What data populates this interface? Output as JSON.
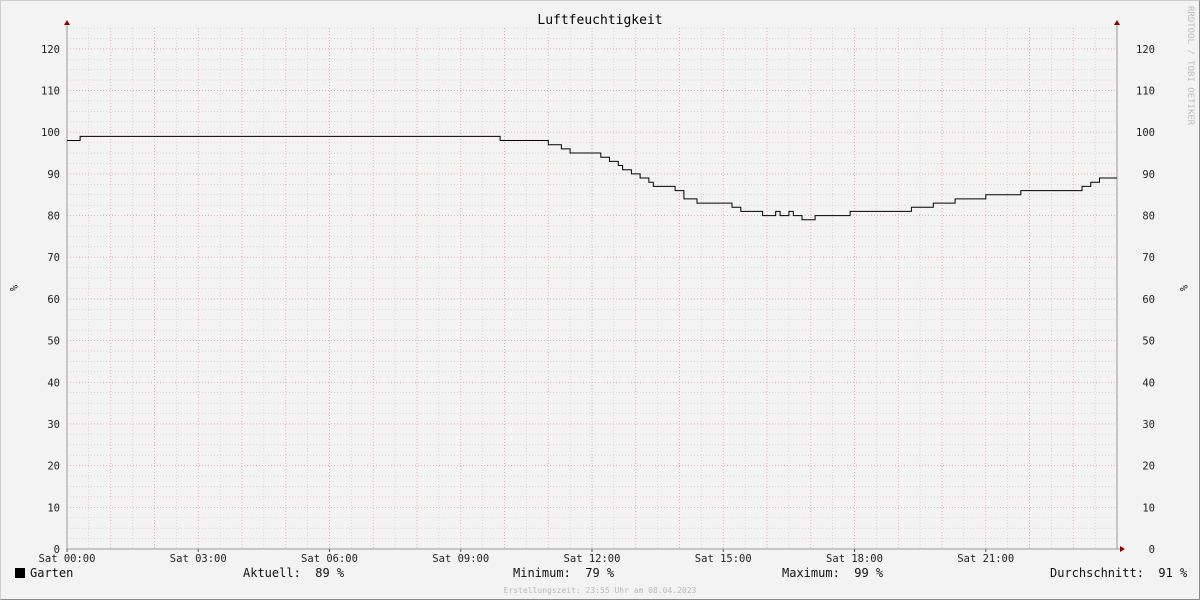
{
  "watermark": "RRDTOOL / TOBI OETIKER",
  "credit": "Erstellungszeit: 23:55 Uhr am 08.04.2023",
  "legend": {
    "series_name": "Garten",
    "current_label": "Aktuell:",
    "current_value": "89 %",
    "min_label": "Minimum:",
    "min_value": "79 %",
    "max_label": "Maximum:",
    "max_value": "99 %",
    "avg_label": "Durchschnitt:",
    "avg_value": "91 %"
  },
  "colors": {
    "line": "#000000",
    "major_grid": "#f0a0a0",
    "minor_grid": "#c8c8c8",
    "axis": "#999999",
    "arrow": "#990000"
  },
  "chart_data": {
    "type": "line",
    "title": "Luftfeuchtigkeit",
    "ylabel_left": "%",
    "ylabel_right": "%",
    "xlim": [
      0,
      24
    ],
    "ylim": [
      0,
      125
    ],
    "x_ticks": [
      {
        "x": 0,
        "label": "Sat 00:00"
      },
      {
        "x": 3,
        "label": "Sat 03:00"
      },
      {
        "x": 6,
        "label": "Sat 06:00"
      },
      {
        "x": 9,
        "label": "Sat 09:00"
      },
      {
        "x": 12,
        "label": "Sat 12:00"
      },
      {
        "x": 15,
        "label": "Sat 15:00"
      },
      {
        "x": 18,
        "label": "Sat 18:00"
      },
      {
        "x": 21,
        "label": "Sat 21:00"
      }
    ],
    "y_ticks": [
      {
        "y": 0,
        "label": "0"
      },
      {
        "y": 10,
        "label": "10"
      },
      {
        "y": 20,
        "label": "20"
      },
      {
        "y": 30,
        "label": "30"
      },
      {
        "y": 40,
        "label": "40"
      },
      {
        "y": 50,
        "label": "50"
      },
      {
        "y": 60,
        "label": "60"
      },
      {
        "y": 70,
        "label": "70"
      },
      {
        "y": 80,
        "label": "80"
      },
      {
        "y": 90,
        "label": "90"
      },
      {
        "y": 100,
        "label": "100"
      },
      {
        "y": 110,
        "label": "110"
      },
      {
        "y": 120,
        "label": "120"
      }
    ],
    "grid": true,
    "legend_position": "bottom",
    "series": [
      {
        "name": "Garten",
        "step": true,
        "points": [
          [
            0.0,
            98
          ],
          [
            0.3,
            99
          ],
          [
            9.9,
            98
          ],
          [
            11.0,
            97
          ],
          [
            11.3,
            96
          ],
          [
            11.5,
            95
          ],
          [
            12.2,
            94
          ],
          [
            12.4,
            93
          ],
          [
            12.6,
            92
          ],
          [
            12.7,
            91
          ],
          [
            12.9,
            90
          ],
          [
            13.1,
            89
          ],
          [
            13.3,
            88
          ],
          [
            13.4,
            87
          ],
          [
            13.9,
            86
          ],
          [
            14.1,
            84
          ],
          [
            14.4,
            83
          ],
          [
            15.2,
            82
          ],
          [
            15.4,
            81
          ],
          [
            15.9,
            80
          ],
          [
            16.2,
            81
          ],
          [
            16.3,
            80
          ],
          [
            16.5,
            81
          ],
          [
            16.6,
            80
          ],
          [
            16.8,
            79
          ],
          [
            17.1,
            80
          ],
          [
            17.9,
            81
          ],
          [
            19.3,
            82
          ],
          [
            19.8,
            83
          ],
          [
            20.3,
            84
          ],
          [
            21.0,
            85
          ],
          [
            21.8,
            86
          ],
          [
            23.2,
            87
          ],
          [
            23.4,
            88
          ],
          [
            23.6,
            89
          ],
          [
            24.0,
            89
          ]
        ]
      }
    ]
  }
}
